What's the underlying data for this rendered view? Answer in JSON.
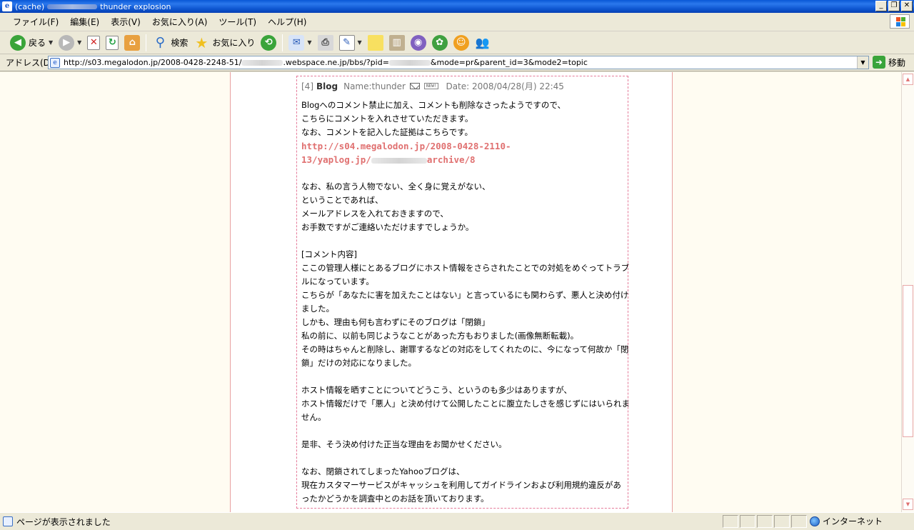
{
  "window": {
    "title_prefix": "(cache)",
    "title_suffix": "thunder explosion"
  },
  "menu": [
    "ファイル(F)",
    "編集(E)",
    "表示(V)",
    "お気に入り(A)",
    "ツール(T)",
    "ヘルプ(H)"
  ],
  "toolbar": {
    "back_label": "戻る",
    "search_label": "検索",
    "favorites_label": "お気に入り"
  },
  "address": {
    "label": "アドレス(D)",
    "url_part1": "http://s03.megalodon.jp/2008-0428-2248-51/",
    "url_part2": ".webspace.ne.jp/bbs/?pid=",
    "url_part3": "&mode=pr&parent_id=3&mode2=topic",
    "go_label": "移動"
  },
  "post": {
    "number": "[4]",
    "title": "Blog",
    "name_label": "Name:thunder",
    "new_badge": "NEW!",
    "date": "Date: 2008/04/28(月) 22:45",
    "link_line1": "http://s04.megalodon.jp/2008-0428-2110-",
    "link_line2_prefix": "13/yaplog.jp/",
    "link_line2_suffix": "archive/8",
    "lines_a": [
      "Blogへのコメント禁止に加え、コメントも削除なさったようですので、",
      "こちらにコメントを入れさせていただきます。",
      "なお、コメントを記入した証拠はこちらです。"
    ],
    "lines_b": [
      "なお、私の言う人物でない、全く身に覚えがない、",
      "ということであれば、",
      "メールアドレスを入れておきますので、",
      "お手数ですがご連絡いただけますでしょうか。"
    ],
    "lines_c": [
      "[コメント内容]",
      "ここの管理人様にとあるブログにホスト情報をさらされたことでの対処をめぐってトラブ",
      "ルになっています。",
      "こちらが「あなたに害を加えたことはない」と言っているにも関わらず、悪人と決め付け",
      "ました。",
      "しかも、理由も何も言わずにそのブログは「閉鎖」",
      "私の前に、以前も同じようなことがあった方もおりました(画像無断転載)。",
      "その時はちゃんと削除し、謝罪するなどの対応をしてくれたのに、今になって何故か「閉",
      "鎖」だけの対応になりました。"
    ],
    "lines_d": [
      "ホスト情報を晒すことについてどうこう、というのも多少はありますが、",
      "ホスト情報だけで「悪人」と決め付けて公開したことに腹立たしさを感じずにはいられま",
      "せん。"
    ],
    "lines_e": [
      "是非、そう決め付けた正当な理由をお聞かせください。"
    ],
    "lines_f": [
      "なお、閉鎖されてしまったYahooブログは、",
      "現在カスタマーサービスがキャッシュを利用してガイドラインおよび利用規約違反があ",
      "ったかどうかを調査中とのお話を頂いております。"
    ]
  },
  "status": {
    "message": "ページが表示されました",
    "zone": "インターネット"
  }
}
